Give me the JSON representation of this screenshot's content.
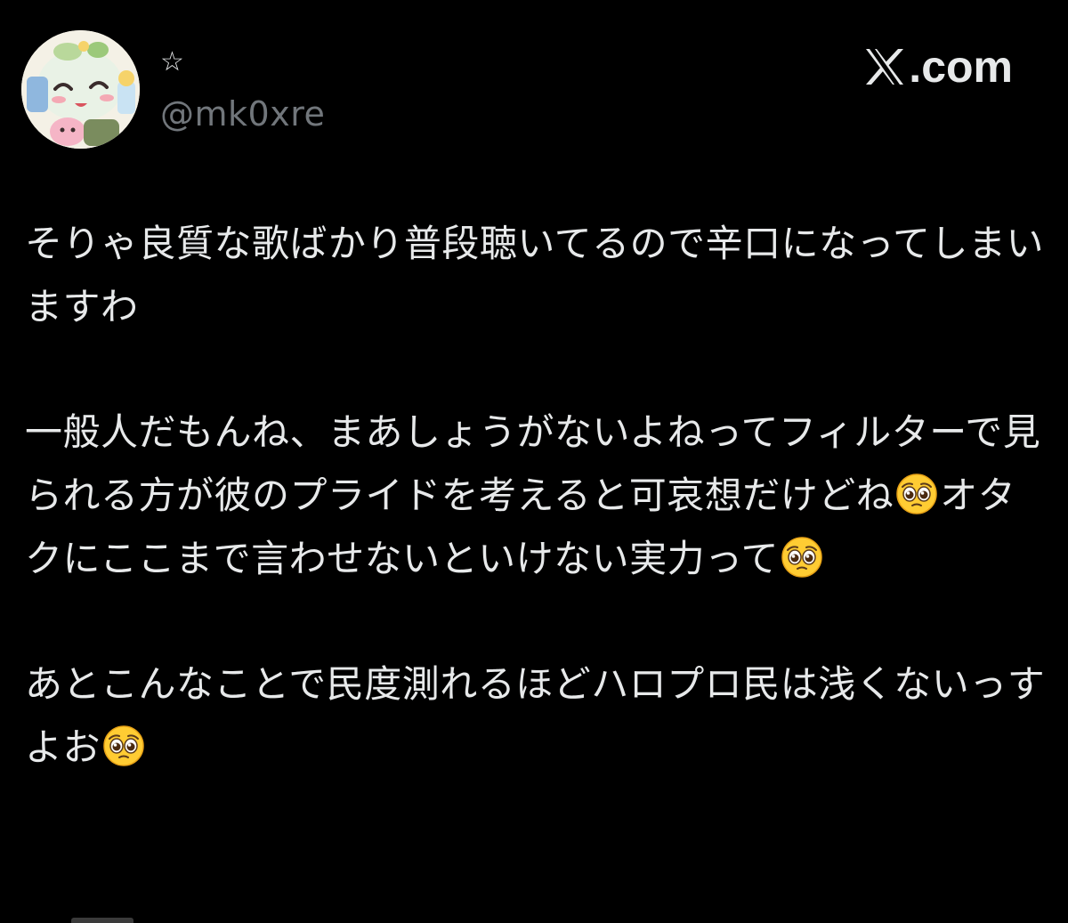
{
  "post": {
    "author": {
      "display_name": "☆",
      "handle": "@mk0xre",
      "avatar_icon": "anime-character-avatar"
    },
    "brand": {
      "label": ".com",
      "icon": "x-logo-icon"
    },
    "paragraphs": [
      {
        "segments": [
          {
            "type": "text",
            "value": "そりゃ良質な歌ばかり普段聴いてるので辛口になってしまいますわ"
          }
        ]
      },
      {
        "segments": [
          {
            "type": "text",
            "value": "一般人だもんね、まあしょうがないよねってフィルターで見られる方が彼のプライドを考えると可哀想だけどね"
          },
          {
            "type": "emoji",
            "value": "pleading-face"
          },
          {
            "type": "text",
            "value": "オタクにここまで言わせないといけない実力って"
          },
          {
            "type": "emoji",
            "value": "pleading-face"
          }
        ]
      },
      {
        "segments": [
          {
            "type": "text",
            "value": "あとこんなことで民度測れるほどハロプロ民は浅くないっすよお"
          },
          {
            "type": "emoji",
            "value": "pleading-face"
          }
        ]
      }
    ]
  },
  "colors": {
    "background": "#000000",
    "text_primary": "#e7e9ea",
    "text_secondary": "#71767b"
  }
}
